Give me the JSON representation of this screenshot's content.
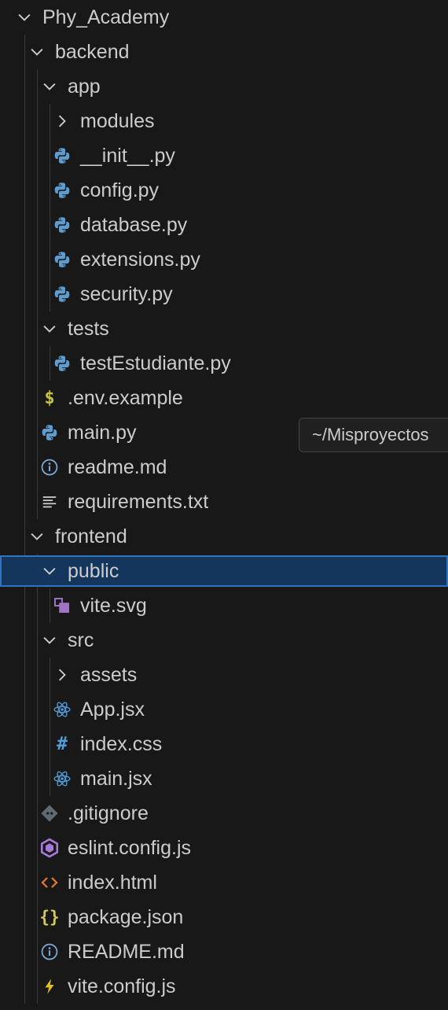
{
  "explorer": {
    "items": [
      {
        "label": "Phy_Academy",
        "kind": "folder-open",
        "depth": 0
      },
      {
        "label": "backend",
        "kind": "folder-open",
        "depth": 1
      },
      {
        "label": "app",
        "kind": "folder-open",
        "depth": 2
      },
      {
        "label": "modules",
        "kind": "folder-closed",
        "depth": 3
      },
      {
        "label": "__init__.py",
        "kind": "python",
        "depth": 3
      },
      {
        "label": "config.py",
        "kind": "python",
        "depth": 3
      },
      {
        "label": "database.py",
        "kind": "python",
        "depth": 3
      },
      {
        "label": "extensions.py",
        "kind": "python",
        "depth": 3
      },
      {
        "label": "security.py",
        "kind": "python",
        "depth": 3
      },
      {
        "label": "tests",
        "kind": "folder-open",
        "depth": 2
      },
      {
        "label": "testEstudiante.py",
        "kind": "python",
        "depth": 3
      },
      {
        "label": ".env.example",
        "kind": "env",
        "depth": 2
      },
      {
        "label": "main.py",
        "kind": "python",
        "depth": 2
      },
      {
        "label": "readme.md",
        "kind": "info",
        "depth": 2
      },
      {
        "label": "requirements.txt",
        "kind": "lines",
        "depth": 2
      },
      {
        "label": "frontend",
        "kind": "folder-open",
        "depth": 1
      },
      {
        "label": "public",
        "kind": "folder-open",
        "depth": 2,
        "selected": true
      },
      {
        "label": "vite.svg",
        "kind": "svg",
        "depth": 3
      },
      {
        "label": "src",
        "kind": "folder-open",
        "depth": 2
      },
      {
        "label": "assets",
        "kind": "folder-closed",
        "depth": 3
      },
      {
        "label": "App.jsx",
        "kind": "react",
        "depth": 3
      },
      {
        "label": "index.css",
        "kind": "css",
        "depth": 3
      },
      {
        "label": "main.jsx",
        "kind": "react",
        "depth": 3
      },
      {
        "label": ".gitignore",
        "kind": "git",
        "depth": 2
      },
      {
        "label": "eslint.config.js",
        "kind": "eslint",
        "depth": 2
      },
      {
        "label": "index.html",
        "kind": "html",
        "depth": 2
      },
      {
        "label": "package.json",
        "kind": "json",
        "depth": 2
      },
      {
        "label": "README.md",
        "kind": "info",
        "depth": 2
      },
      {
        "label": "vite.config.js",
        "kind": "vite",
        "depth": 2
      }
    ]
  },
  "tooltip": {
    "text": "~/Misproyectos"
  },
  "colors": {
    "background": "#181818",
    "selected_bg": "#14365d",
    "selected_border": "#2f74c0",
    "text": "#cccccc",
    "python": "#5e9ccf",
    "env": "#c5c538",
    "info": "#7aa6d6",
    "svg": "#a074c4",
    "react": "#4f9cd6",
    "css": "#4f9cd6",
    "git": "#5f6a73",
    "eslint": "#a67ad6",
    "html": "#e37933",
    "json": "#d4c95a",
    "vite": "#e5c025"
  }
}
